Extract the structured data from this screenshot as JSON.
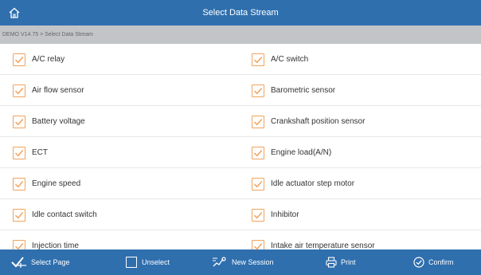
{
  "header": {
    "title": "Select Data Stream",
    "home_icon": "home-icon"
  },
  "breadcrumb": "DEMO V14.75 > Select Data Stream",
  "colors": {
    "bar": "#2f6fae",
    "breadcrumb_bg": "#c3c4c7",
    "checkbox": "#f2a35d"
  },
  "items": [
    {
      "left": "A/C relay",
      "right": "A/C switch"
    },
    {
      "left": "Air flow sensor",
      "right": "Barometric sensor"
    },
    {
      "left": "Battery voltage",
      "right": "Crankshaft position sensor"
    },
    {
      "left": "ECT",
      "right": "Engine load(A/N)"
    },
    {
      "left": "Engine speed",
      "right": "Idle actuator step motor"
    },
    {
      "left": "Idle contact switch",
      "right": "Inhibitor"
    },
    {
      "left": "Injection time",
      "right": "Intake air temperature sensor"
    }
  ],
  "toolbar": {
    "select_page": "Select Page",
    "unselect": "Unselect",
    "new_session": "New Session",
    "print": "Print",
    "confirm": "Confirm"
  }
}
